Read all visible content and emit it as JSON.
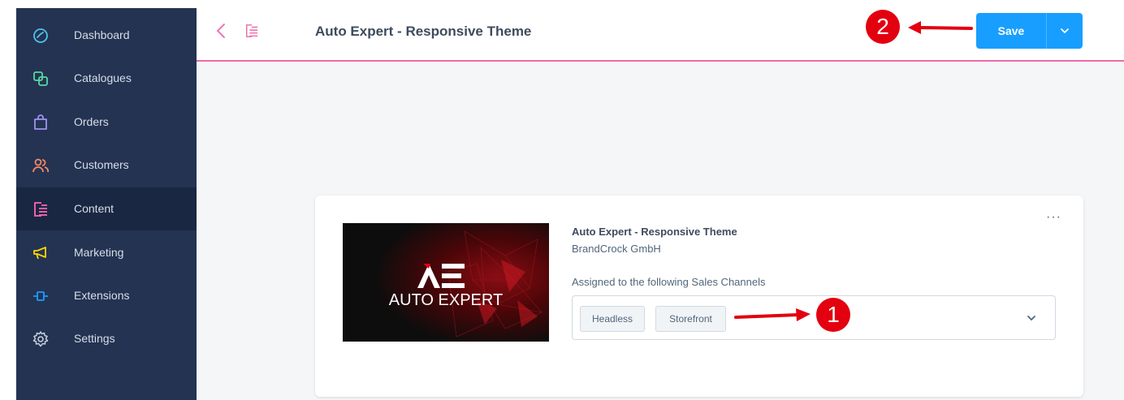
{
  "sidebar": {
    "items": [
      {
        "label": "Dashboard",
        "icon": "gauge-icon"
      },
      {
        "label": "Catalogues",
        "icon": "catalogue-icon"
      },
      {
        "label": "Orders",
        "icon": "shopping-bag-icon"
      },
      {
        "label": "Customers",
        "icon": "customers-icon"
      },
      {
        "label": "Content",
        "icon": "content-icon",
        "active": true
      },
      {
        "label": "Marketing",
        "icon": "megaphone-icon"
      },
      {
        "label": "Extensions",
        "icon": "plug-icon"
      },
      {
        "label": "Settings",
        "icon": "gear-icon"
      }
    ]
  },
  "header": {
    "title": "Auto Expert - Responsive Theme",
    "save_label": "Save"
  },
  "theme": {
    "logo_text": "AUTO EXPERT",
    "name": "Auto Expert - Responsive Theme",
    "author": "BrandCrock GmbH",
    "assigned_label": "Assigned to the following Sales Channels",
    "channels": [
      "Headless",
      "Storefront"
    ],
    "more_label": "···"
  },
  "annotations": {
    "badge_1": "1",
    "badge_2": "2"
  },
  "colors": {
    "sidebar_bg": "#243352",
    "accent_pink": "#ee69a8",
    "save_blue": "#189eff",
    "annotation_red": "#e3000f"
  }
}
